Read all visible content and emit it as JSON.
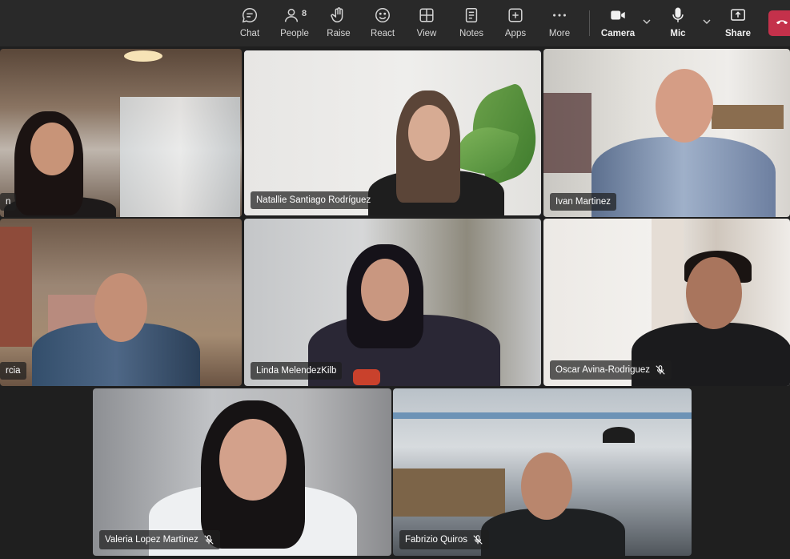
{
  "toolbar": {
    "chat": "Chat",
    "people": "People",
    "people_count": "8",
    "raise": "Raise",
    "react": "React",
    "view": "View",
    "notes": "Notes",
    "apps": "Apps",
    "more": "More",
    "camera": "Camera",
    "mic": "Mic",
    "share": "Share"
  },
  "participants": [
    {
      "name": "n",
      "muted": false
    },
    {
      "name": "Natallie Santiago Rodríguez",
      "muted": false,
      "active": true
    },
    {
      "name": "Ivan Martinez",
      "muted": false
    },
    {
      "name": "rcia",
      "muted": false
    },
    {
      "name": "Linda MelendezKilb",
      "muted": false
    },
    {
      "name": "Oscar Avina-Rodriguez",
      "muted": true
    },
    {
      "name": "Valeria Lopez Martinez",
      "muted": true
    },
    {
      "name": "Fabrizio Quiros",
      "muted": true
    }
  ],
  "colors": {
    "accent": "#8b8cf6",
    "leave": "#c4314b",
    "toolbar": "#292929",
    "stage": "#1f1f1f"
  }
}
